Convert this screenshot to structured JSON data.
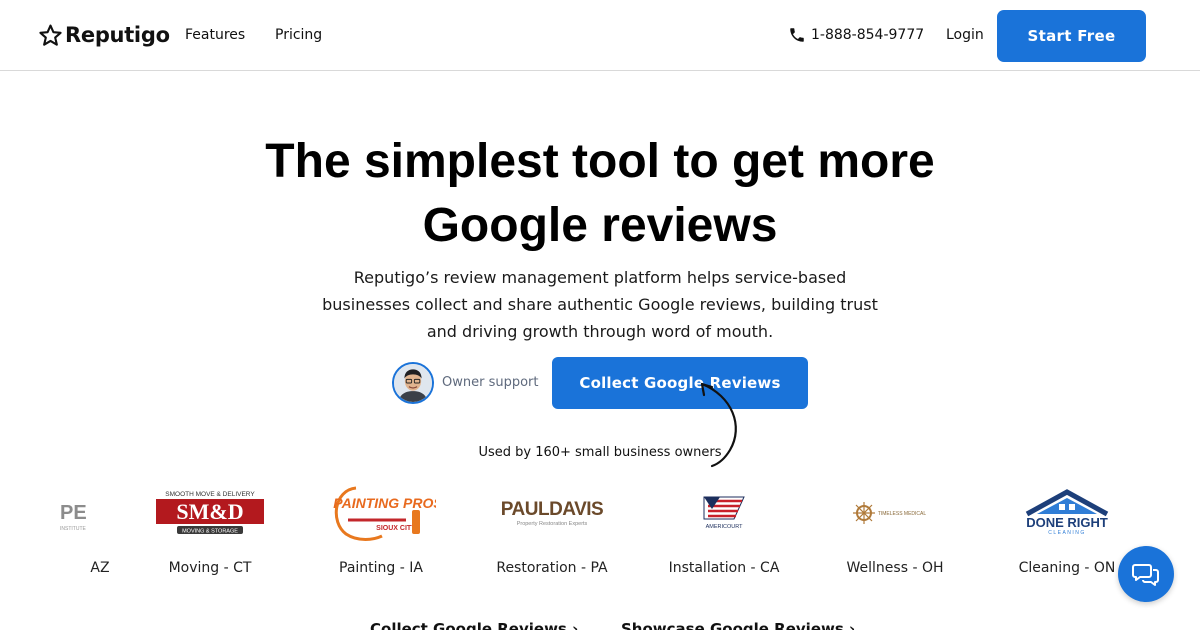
{
  "header": {
    "brand": "Reputigo",
    "nav": [
      {
        "label": "Features"
      },
      {
        "label": "Pricing"
      }
    ],
    "phone": "1-888-854-9777",
    "login_label": "Login",
    "cta_label": "Start Free"
  },
  "hero": {
    "title_line1": "The simplest tool to get more",
    "title_line2": "Google reviews",
    "subtitle": "Reputigo’s review management platform helps service-based businesses collect and share authentic Google reviews, building trust and driving growth through word of mouth.",
    "owner_support_label": "Owner support",
    "cta_label": "Collect Google Reviews",
    "used_by": "Used by 160+ small business owners"
  },
  "businesses": [
    {
      "logo_text": "PE",
      "caption": "AZ"
    },
    {
      "logo_text": "SM&D",
      "logo_top": "SMOOTH MOVE & DELIVERY",
      "logo_bottom": "MOVING & STORAGE",
      "caption": "Moving - CT"
    },
    {
      "logo_text": "PAINTING PROS",
      "logo_sub": "SIOUX CITY",
      "caption": "Painting - IA"
    },
    {
      "logo_text": "PAULDAVIS",
      "logo_sub": "Property Restoration Experts",
      "caption": "Restoration - PA"
    },
    {
      "logo_text": "AMERICOURT",
      "caption": "Installation - CA"
    },
    {
      "logo_text": "TIMELESS MEDICAL",
      "caption": "Wellness - OH"
    },
    {
      "logo_text": "DONE RIGHT",
      "logo_sub": "CLEANING",
      "caption": "Cleaning - ON"
    }
  ],
  "bottom_links": [
    {
      "label": "Collect Google Reviews ›"
    },
    {
      "label": "Showcase Google Reviews ›"
    }
  ],
  "colors": {
    "accent": "#1a73d9",
    "text": "#111111",
    "muted": "#5f6a7d"
  }
}
